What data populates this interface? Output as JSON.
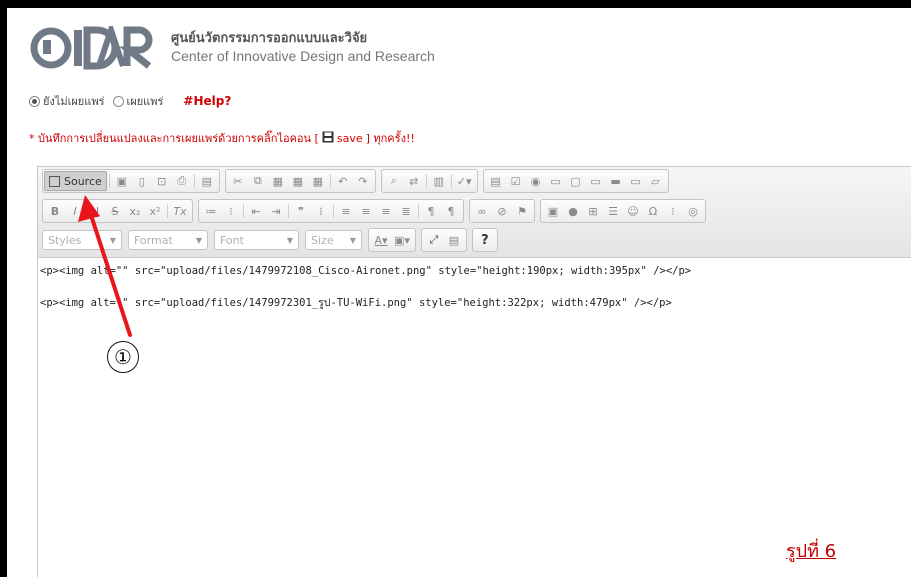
{
  "header": {
    "title_th": "ศูนย์นวัตกรรมการออกแบบและวิจัย",
    "title_en": "Center of Innovative Design and Research"
  },
  "publish": {
    "options": [
      {
        "label": "ยังไม่เผยแพร่",
        "selected": true
      },
      {
        "label": "เผยแพร่",
        "selected": false
      }
    ],
    "help_label": "#Help?"
  },
  "note": {
    "prefix": "* บันทึกการเปลี่ยนแปลงและการเผยแพร่ด้วยการคลิ๊กไอคอน [",
    "save_label": "save",
    "suffix": "] ทุกครั้ง!!"
  },
  "toolbar": {
    "source_label": "Source",
    "styles_label": "Styles",
    "format_label": "Format",
    "font_label": "Font",
    "size_label": "Size",
    "bold_label": "B",
    "italic_label": "I",
    "underline_label": "U",
    "strike_label": "S",
    "subscript_label": "x₂",
    "superscript_label": "x²",
    "remove_format_label": "Tx",
    "text_color_label": "A",
    "help_label": "?"
  },
  "editor": {
    "lines": [
      "<p><img alt=\"\" src=\"upload/files/1479972108_Cisco-Aironet.png\" style=\"height:190px; width:395px\" /></p>",
      "<p><img alt=\"\" src=\"upload/files/1479972301_รูป-TU-WiFi.png\" style=\"height:322px; width:479px\" /></p>"
    ]
  },
  "annotation": {
    "step_number": "①",
    "figure_label": "รูปที่ 6",
    "arrow_color": "#e8161b"
  }
}
